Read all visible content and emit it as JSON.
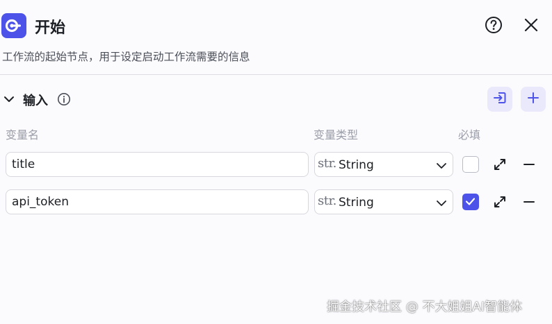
{
  "header": {
    "title": "开始",
    "description": "工作流的起始节点，用于设定启动工作流需要的信息",
    "logo_icon": "workflow-start-logo-icon",
    "help_icon": "question-circle-icon",
    "close_icon": "close-icon"
  },
  "inputs_section": {
    "title": "输入",
    "info_icon": "info-circle-icon",
    "toggle_icon": "chevron-down-icon",
    "import_icon": "import-icon",
    "add_icon": "plus-icon",
    "columns": {
      "name": "变量名",
      "type": "变量类型",
      "required": "必填"
    },
    "rows": [
      {
        "name": "title",
        "type_prefix": "str.",
        "type": "String",
        "required": false
      },
      {
        "name": "api_token",
        "type_prefix": "str.",
        "type": "String",
        "required": true
      }
    ]
  },
  "watermark": "掘金技术社区 @ 不大姐姐AI智能体",
  "colors": {
    "accent": "#4d53e8",
    "accent_light": "#e9e9fb",
    "background": "#fbfbfe",
    "border": "#d6d8de",
    "muted_text": "#9b9ea8"
  }
}
